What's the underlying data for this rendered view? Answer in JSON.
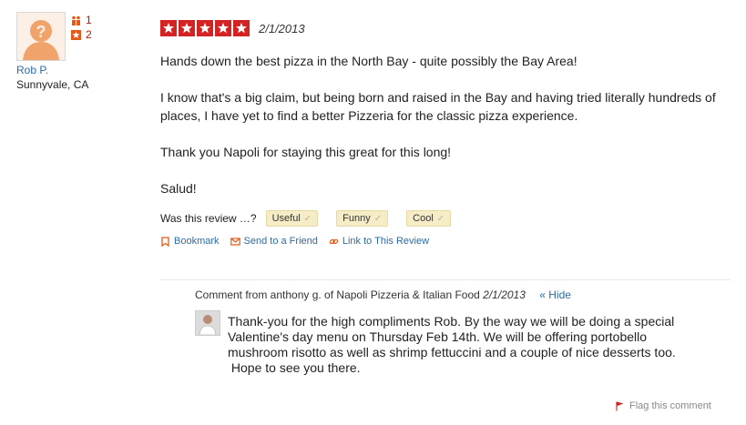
{
  "user": {
    "name": "Rob P.",
    "location": "Sunnyvale, CA",
    "friends_count": "1",
    "reviews_count": "2"
  },
  "review": {
    "stars": 5,
    "date": "2/1/2013",
    "paragraphs": [
      "Hands down the best pizza in the North Bay - quite possibly the Bay Area!",
      "I know that's a big claim, but being born and raised in the Bay and having tried literally hundreds of places, I have yet to find a better Pizzeria for the classic pizza experience.",
      "Thank you Napoli for staying this great for this long!",
      "Salud!"
    ]
  },
  "feedback": {
    "prompt": "Was this review …?",
    "useful": "Useful",
    "funny": "Funny",
    "cool": "Cool"
  },
  "actions": {
    "bookmark": "Bookmark",
    "send": "Send to a Friend",
    "link": "Link to This Review"
  },
  "comment": {
    "header": "Comment from anthony g. of Napoli Pizzeria & Italian Food",
    "date": "2/1/2013",
    "hide": "« Hide",
    "text_lines": [
      "Thank-you for the high compliments Rob.  By the way we will be doing a special",
      "Valentine's day menu on Thursday Feb 14th.  We will be offering portobello",
      "mushroom risotto as well as shrimp fettuccini and a couple of nice desserts too.",
      " Hope to see you there."
    ]
  },
  "flag": {
    "label": "Flag this comment"
  },
  "colors": {
    "star_red": "#d32323",
    "link_blue": "#2b6ca3",
    "button_bg": "#f6edc7"
  }
}
